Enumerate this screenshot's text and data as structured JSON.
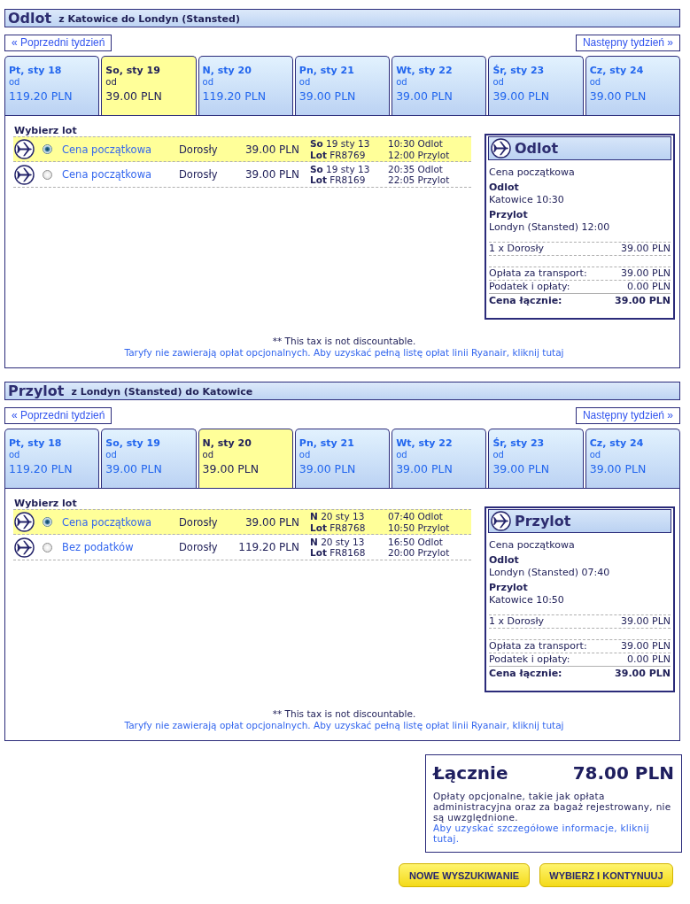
{
  "sections": [
    {
      "title": "Odlot",
      "route": "z Katowice do Londyn (Stansted)",
      "prev_week": "« Poprzedni tydzień",
      "next_week": "Następny tydzień »",
      "days": [
        {
          "date": "Pt, sty 18",
          "from": "od",
          "price": "119.20 PLN",
          "selected": false
        },
        {
          "date": "So, sty 19",
          "from": "od",
          "price": "39.00 PLN",
          "selected": true
        },
        {
          "date": "N, sty 20",
          "from": "od",
          "price": "119.20 PLN",
          "selected": false
        },
        {
          "date": "Pn, sty 21",
          "from": "od",
          "price": "39.00 PLN",
          "selected": false
        },
        {
          "date": "Wt, sty 22",
          "from": "od",
          "price": "39.00 PLN",
          "selected": false
        },
        {
          "date": "Śr, sty 23",
          "from": "od",
          "price": "39.00 PLN",
          "selected": false
        },
        {
          "date": "Cz, sty 24",
          "from": "od",
          "price": "39.00 PLN",
          "selected": false
        }
      ],
      "choose_label": "Wybierz lot",
      "flights": [
        {
          "selected": true,
          "fare": "Cena początkowa",
          "passenger": "Dorosły",
          "price": "39.00 PLN",
          "date": "**So** 19 sty 13",
          "flight": "**Lot** FR8769",
          "departure": "10:30 Odlot",
          "arrival": "12:00 Przylot"
        },
        {
          "selected": false,
          "fare": "Cena początkowa",
          "passenger": "Dorosły",
          "price": "39.00 PLN",
          "date": "**So** 19 sty 13",
          "flight": "**Lot** FR8169",
          "departure": "20:35 Odlot",
          "arrival": "22:05 Przylot"
        }
      ],
      "summary": {
        "title": "Odlot",
        "fare": "Cena początkowa",
        "departure_label": "Odlot",
        "departure": "Katowice 10:30",
        "arrival_label": "Przylot",
        "arrival": "Londyn (Stansted) 12:00",
        "lines": [
          {
            "kind": "item",
            "label": "1 x Dorosły",
            "value": "39.00 PLN"
          },
          {
            "kind": "fee",
            "label": "Opłata za transport:",
            "value": "39.00 PLN"
          },
          {
            "kind": "fee",
            "label": "Podatek i opłaty:",
            "value": "0.00 PLN"
          },
          {
            "kind": "total",
            "label": "Cena łącznie:",
            "value": "39.00 PLN"
          }
        ]
      },
      "tax_note": "** This tax is not discountable.",
      "fees_link": "Taryfy nie zawierają opłat opcjonalnych. Aby uzyskać pełną listę opłat linii Ryanair, kliknij tutaj"
    },
    {
      "title": "Przylot",
      "route": "z Londyn (Stansted) do Katowice",
      "prev_week": "« Poprzedni tydzień",
      "next_week": "Następny tydzień »",
      "days": [
        {
          "date": "Pt, sty 18",
          "from": "od",
          "price": "119.20 PLN",
          "selected": false
        },
        {
          "date": "So, sty 19",
          "from": "od",
          "price": "39.00 PLN",
          "selected": false
        },
        {
          "date": "N, sty 20",
          "from": "od",
          "price": "39.00 PLN",
          "selected": true
        },
        {
          "date": "Pn, sty 21",
          "from": "od",
          "price": "39.00 PLN",
          "selected": false
        },
        {
          "date": "Wt, sty 22",
          "from": "od",
          "price": "39.00 PLN",
          "selected": false
        },
        {
          "date": "Śr, sty 23",
          "from": "od",
          "price": "39.00 PLN",
          "selected": false
        },
        {
          "date": "Cz, sty 24",
          "from": "od",
          "price": "39.00 PLN",
          "selected": false
        }
      ],
      "choose_label": "Wybierz lot",
      "flights": [
        {
          "selected": true,
          "fare": "Cena początkowa",
          "passenger": "Dorosły",
          "price": "39.00 PLN",
          "date": "**N** 20 sty 13",
          "flight": "**Lot** FR8768",
          "departure": "07:40 Odlot",
          "arrival": "10:50 Przylot"
        },
        {
          "selected": false,
          "fare": "Bez podatków",
          "passenger": "Dorosły",
          "price": "119.20 PLN",
          "date": "**N** 20 sty 13",
          "flight": "**Lot** FR8168",
          "departure": "16:50 Odlot",
          "arrival": "20:00 Przylot"
        }
      ],
      "summary": {
        "title": "Przylot",
        "fare": "Cena początkowa",
        "departure_label": "Odlot",
        "departure": "Londyn (Stansted) 07:40",
        "arrival_label": "Przylot",
        "arrival": "Katowice 10:50",
        "lines": [
          {
            "kind": "item",
            "label": "1 x Dorosły",
            "value": "39.00 PLN"
          },
          {
            "kind": "fee",
            "label": "Opłata za transport:",
            "value": "39.00 PLN"
          },
          {
            "kind": "fee",
            "label": "Podatek i opłaty:",
            "value": "0.00 PLN"
          },
          {
            "kind": "total",
            "label": "Cena łącznie:",
            "value": "39.00 PLN"
          }
        ]
      },
      "tax_note": "** This tax is not discountable.",
      "fees_link": "Taryfy nie zawierają opłat opcjonalnych. Aby uzyskać pełną listę opłat linii Ryanair, kliknij tutaj"
    }
  ],
  "total": {
    "label": "Łącznie",
    "amount": "78.00 PLN",
    "note": "Opłaty opcjonalne, takie jak opłata administracyjna oraz za bagaż rejestrowany, nie są uwzględnione.",
    "link": "Aby uzyskać szczegółowe informacje, kliknij tutaj."
  },
  "buttons": [
    "NOWE WYSZUKIWANIE",
    "WYBIERZ I KONTYNUUJ"
  ]
}
